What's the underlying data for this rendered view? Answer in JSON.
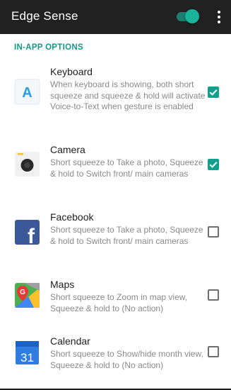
{
  "app_bar": {
    "title": "Edge Sense",
    "toggle_on": true
  },
  "section": {
    "header": "IN-APP OPTIONS"
  },
  "items": [
    {
      "title": "Keyboard",
      "description": "When keyboard is showing, both short squeeze and squeeze & hold will activate Voice-to-Text when gesture is enabled",
      "checked": true,
      "icon": "keyboard-app-icon",
      "icon_glyph": "A"
    },
    {
      "title": "Camera",
      "description": "Short squeeze to Take a photo, Squeeze & hold to Switch front/ main cameras",
      "checked": true,
      "icon": "camera-app-icon"
    },
    {
      "title": "Facebook",
      "description": "Short squeeze to Take a photo, Squeeze & hold to Switch front/ main cameras",
      "checked": false,
      "icon": "facebook-app-icon",
      "icon_glyph": "f"
    },
    {
      "title": "Maps",
      "description": "Short squeeze to Zoom in map view, Squeeze & hold to (No action)",
      "checked": false,
      "icon": "maps-app-icon",
      "icon_glyph": "G"
    },
    {
      "title": "Calendar",
      "description": "Short squeeze to Show/hide month view, Squeeze & hold to (No action)",
      "checked": false,
      "icon": "calendar-app-icon",
      "icon_glyph": "31"
    }
  ],
  "colors": {
    "accent": "#12a08e",
    "app_bar_bg": "#212121",
    "secondary_text": "#8a8a8a"
  }
}
